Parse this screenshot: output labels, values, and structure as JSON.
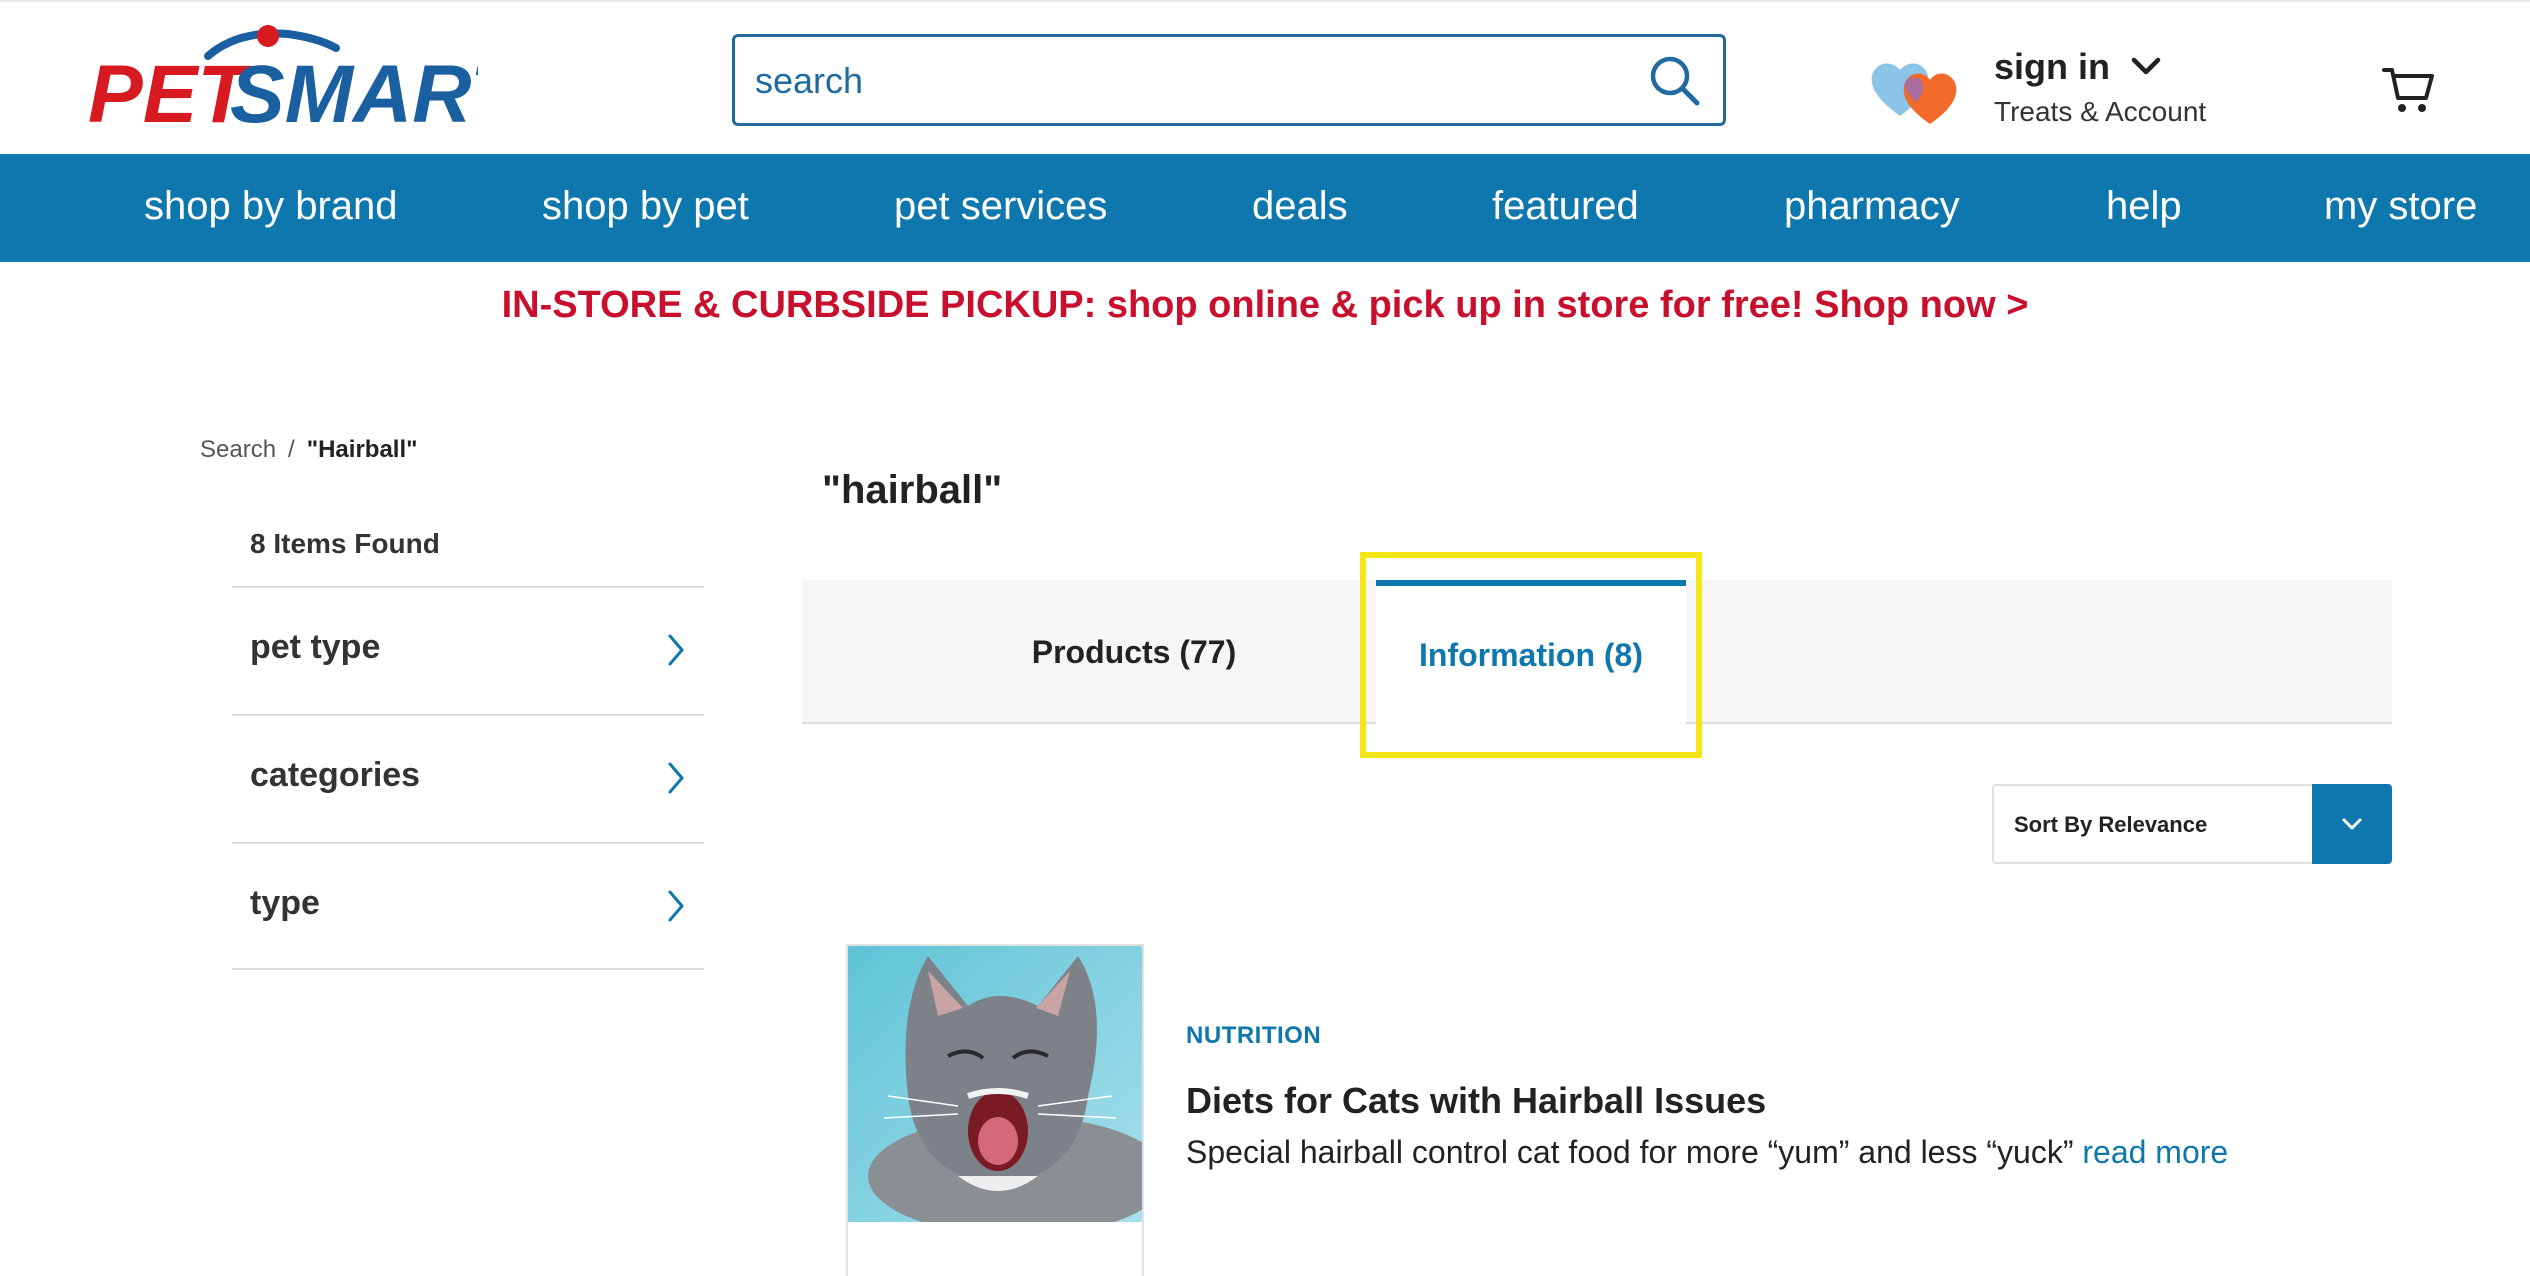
{
  "brand": {
    "logo_text": "PETSMART",
    "primary_color": "#0e77ad",
    "accent_red": "#c8102e"
  },
  "header": {
    "search": {
      "placeholder": "search",
      "value": ""
    },
    "account": {
      "sign_in": "sign in",
      "subtitle": "Treats & Account"
    }
  },
  "nav": {
    "items": [
      "shop by brand",
      "shop by pet",
      "pet services",
      "deals",
      "featured",
      "pharmacy",
      "help",
      "my store"
    ]
  },
  "promo": {
    "text": "IN-STORE & CURBSIDE PICKUP: shop online & pick up in store for free! Shop now >"
  },
  "breadcrumb": {
    "root": "Search",
    "separator": "/",
    "current": "\"Hairball\""
  },
  "sidebar": {
    "items_found": "8 Items Found",
    "filters": [
      "pet type",
      "categories",
      "type"
    ]
  },
  "main": {
    "query_title": "\"hairball\"",
    "tabs": [
      {
        "label": "Products (77)",
        "active": false
      },
      {
        "label": "Information (8)",
        "active": true
      }
    ],
    "sort": {
      "label": "Sort By Relevance"
    },
    "results": [
      {
        "category": "NUTRITION",
        "title": "Diets for Cats with Hairball Issues",
        "description": "Special hairball control cat food for more “yum” and less “yuck”",
        "link": "read more"
      }
    ]
  }
}
